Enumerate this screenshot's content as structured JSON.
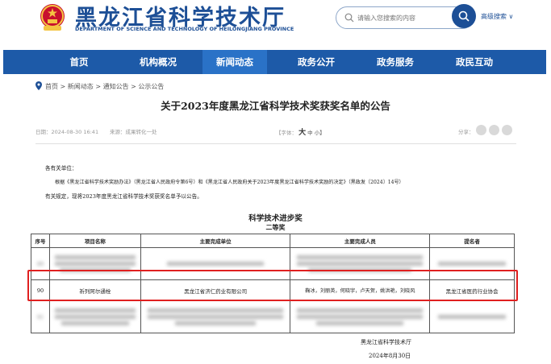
{
  "header": {
    "site_title": "黑龙江省科学技术厅",
    "site_subtitle": "DEPARTMENT OF SCIENCE AND TECHNOLOGY OF HEILONGJIANG PROVINCE",
    "search_placeholder": "请输入您搜索的内容",
    "advanced_search": "高级搜索 ∨"
  },
  "nav": {
    "items": [
      "首页",
      "机构概况",
      "新闻动态",
      "政务公开",
      "政务服务",
      "政民互动"
    ],
    "active": "新闻动态"
  },
  "breadcrumb": "首页 > 新闻动态 > 通知公告 > 公示公告",
  "article": {
    "title": "关于2023年度黑龙江省科学技术奖获奖名单的公告",
    "date": "日期：2024-08-30 16:41",
    "source": "来源：成果转化一处",
    "font_label": "【字体：",
    "font_large": "大",
    "font_medium": "中",
    "font_small": "小】",
    "share_label": "分享：",
    "salutation": "各有关单位：",
    "para1": "根据《黑龙江省科学技术奖励办法》（黑龙江省人民政府令第6号）和《黑龙江省人民政府关于2023年度黑龙江省科学技术奖励的决定》（黑政发〔2024〕14号）",
    "para2": "有关规定，现将2023年度黑龙江省科学技术奖获奖名单予以公告。",
    "award_name": "科学技术进步奖",
    "award_level": "二等奖"
  },
  "table": {
    "headers": [
      "序号",
      "项目名称",
      "主要完成单位",
      "主要完成人员",
      "提名者"
    ],
    "blurred_top": [
      "89",
      "",
      "",
      "",
      ""
    ],
    "highlighted_row": {
      "no": "90",
      "project": "祈列阿尔通栓",
      "unit": "黑龙江省济仁药业有限公司",
      "people": "鞠冰，刘丽英，何晓宇，卢天贺，姚洪艳，刘晓风",
      "nominator": "黑龙江省医药行业协会"
    },
    "blurred_bottom": [
      "91",
      "",
      "",
      "",
      ""
    ]
  },
  "signature": {
    "org": "黑龙江省科学技术厅",
    "date": "2024年8月30日"
  },
  "colors": {
    "brand_blue": "#1d4f96",
    "nav_blue": "#1d5aa8",
    "highlight_red": "#e02020"
  }
}
